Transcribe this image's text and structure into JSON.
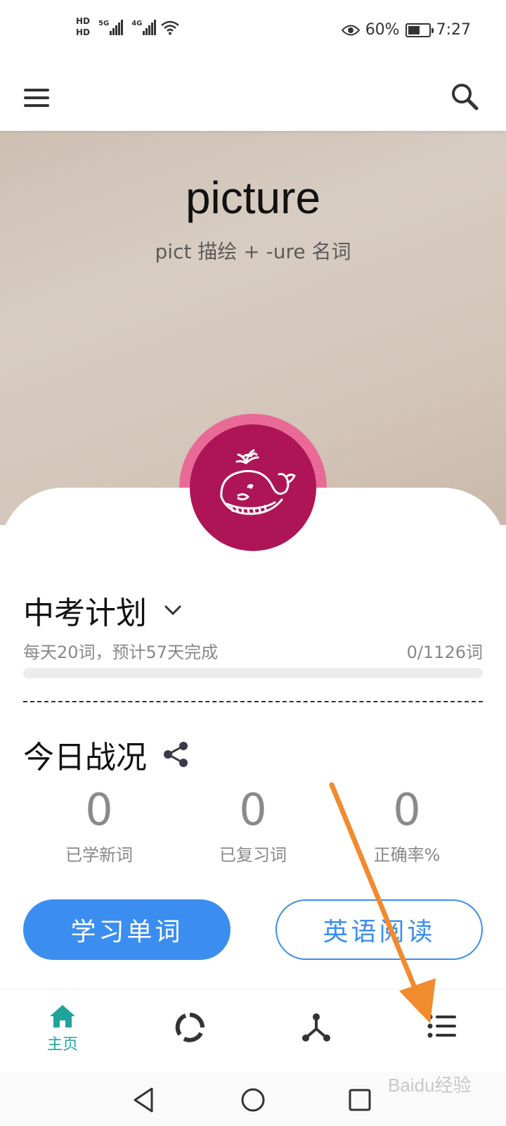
{
  "status_bar": {
    "hd1": "HD",
    "hd2": "HD",
    "net1": "5G",
    "net2": "4G",
    "battery_percent": "60%",
    "battery_level": 0.6,
    "time": "7:27"
  },
  "toolbar": {
    "menu_icon": "menu-icon",
    "search_icon": "search-icon"
  },
  "hero": {
    "word": "picture",
    "etymology": "pict 描绘 + -ure 名词"
  },
  "plan": {
    "title": "中考计划",
    "daily_info": "每天20词，预计57天完成",
    "progress_text": "0/1126词",
    "progress": 0
  },
  "today": {
    "title": "今日战况",
    "stats": [
      {
        "value": "0",
        "label": "已学新词"
      },
      {
        "value": "0",
        "label": "已复习词"
      },
      {
        "value": "0",
        "label": "正确率%"
      }
    ]
  },
  "actions": {
    "primary_label": "学习单词",
    "secondary_label": "英语阅读"
  },
  "bottom_nav": {
    "home_label": "主页",
    "active_color": "#20a39a"
  },
  "colors": {
    "accent": "#3b8ef0",
    "avatar_bg": "#ae1556",
    "avatar_ring": "#ea6a97",
    "annotation_arrow": "#f28a2e"
  },
  "watermark": "Baidu经验"
}
